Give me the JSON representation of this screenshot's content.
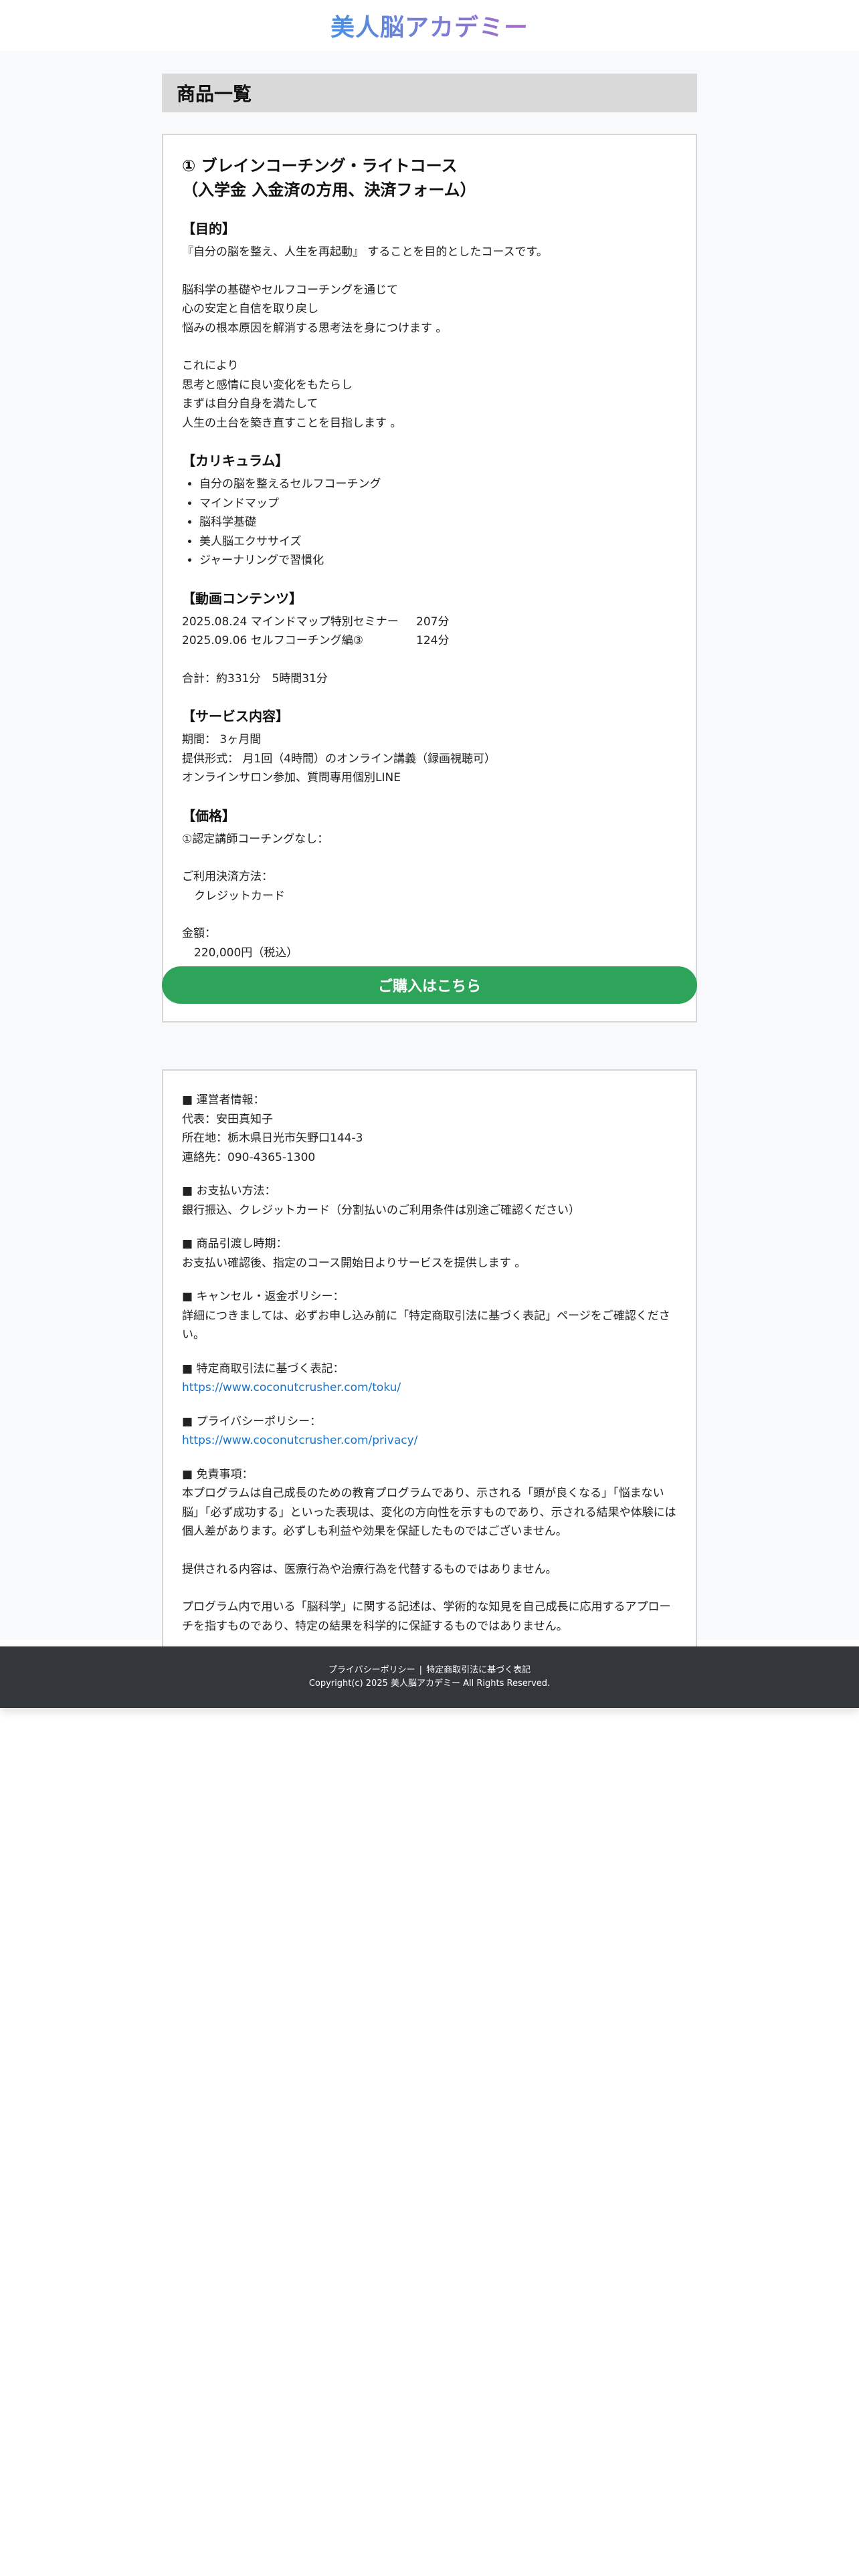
{
  "header": {
    "logo_text": "美人脳アカデミー"
  },
  "section": {
    "title": "商品一覧"
  },
  "product": {
    "title_line1": "① ブレインコーチング・ライトコース",
    "title_line2": "（入学金 入金済の方用、決済フォーム）",
    "purpose": {
      "heading": "【目的】",
      "lines_a": [
        "『自分の脳を整え、人生を再起動』 することを目的としたコースです。"
      ],
      "lines_b": [
        "脳科学の基礎やセルフコーチングを通じて",
        "心の安定と自信を取り戻し",
        "悩みの根本原因を解消する思考法を身につけます 。"
      ],
      "lines_c": [
        "これにより",
        "思考と感情に良い変化をもたらし",
        "まずは自分自身を満たして",
        "人生の土台を築き直すことを目指します 。"
      ]
    },
    "curriculum": {
      "heading": "【カリキュラム】",
      "items": [
        "自分の脳を整えるセルフコーチング",
        "マインドマップ",
        "脳科学基礎",
        "美人脳エクササイズ",
        "ジャーナリングで習慣化"
      ]
    },
    "videos": {
      "heading": "【動画コンテンツ】",
      "items": [
        {
          "title": "2025.08.24 マインドマップ特別セミナー",
          "duration": "207分"
        },
        {
          "title": "2025.09.06 セルフコーチング編③",
          "duration": "124分"
        }
      ],
      "total": "合計：約331分　5時間31分"
    },
    "service": {
      "heading": "【サービス内容】",
      "lines": [
        "期間： 3ヶ月間",
        "提供形式： 月1回（4時間）のオンライン講義（録画視聴可）",
        "オンラインサロン参加、質問専用個別LINE"
      ]
    },
    "price": {
      "heading": "【価格】",
      "option": "①認定講師コーチングなし：",
      "payment_label": "ご利用決済方法：",
      "payment_value": "クレジットカード",
      "amount_label": "金額：",
      "amount_value": "220,000円（税込）"
    },
    "buy_label": "ご購入はこちら"
  },
  "info": {
    "operator": {
      "heading": "■ 運営者情報：",
      "lines": [
        "代表：安田真知子",
        "所在地：栃木県日光市矢野口144-3",
        "連絡先：090-4365-1300"
      ]
    },
    "payment": {
      "heading": "■ お支払い方法：",
      "lines": [
        "銀行振込、クレジットカード（分割払いのご利用条件は別途ご確認ください）"
      ]
    },
    "delivery": {
      "heading": "■ 商品引渡し時期：",
      "lines": [
        "お支払い確認後、指定のコース開始日よりサービスを提供します 。"
      ]
    },
    "cancel": {
      "heading": "■ キャンセル・返金ポリシー：",
      "lines": [
        "詳細につきましては、必ずお申し込み前に「特定商取引法に基づく表記」ページをご確認ください。"
      ]
    },
    "tokushoho": {
      "heading": "■ 特定商取引法に基づく表記：",
      "url": "https://www.coconutcrusher.com/toku/"
    },
    "privacy": {
      "heading": "■ プライバシーポリシー：",
      "url": "https://www.coconutcrusher.com/privacy/"
    },
    "disclaimer": {
      "heading": "■ 免責事項：",
      "p1": "本プログラムは自己成長のための教育プログラムであり、示される「頭が良くなる」「悩まない脳」「必ず成功する」といった表現は、変化の方向性を示すものであり、示される結果や体験には個人差があります。必ずしも利益や効果を保証したものではございません。",
      "p2": "提供される内容は、医療行為や治療行為を代替するものではありません。",
      "p3": "プログラム内で用いる「脳科学」に関する記述は、学術的な知見を自己成長に応用するアプローチを指すものであり、特定の結果を科学的に保証するものではありません。"
    }
  },
  "footer": {
    "link_privacy": "プライバシーポリシー",
    "separator": "|",
    "link_tokushoho": "特定商取引法に基づく表記",
    "copyright": "Copyright(c) 2025 美人脳アカデミー All Rights Reserved."
  },
  "colors": {
    "buy_button": "#2ea35a",
    "link": "#1a73c9",
    "footer_bg": "#33363b",
    "section_bg": "#d9d9d9"
  }
}
